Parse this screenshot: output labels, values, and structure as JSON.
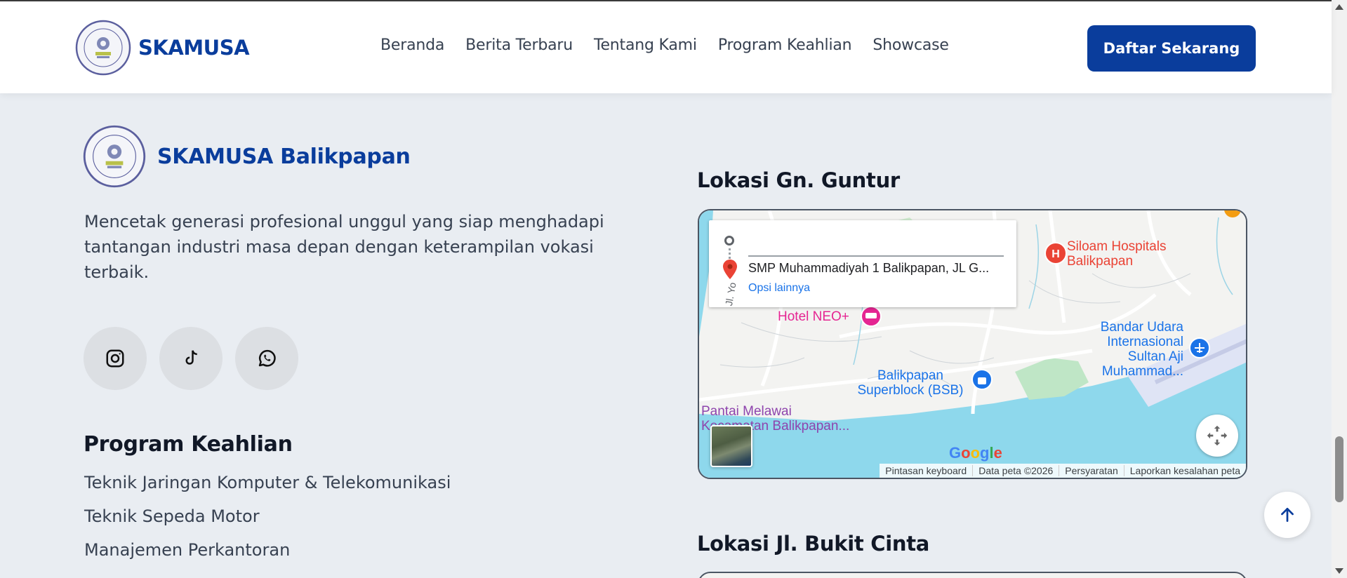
{
  "header": {
    "brand": "SKAMUSA",
    "nav": [
      "Beranda",
      "Berita Terbaru",
      "Tentang Kami",
      "Program Keahlian",
      "Showcase"
    ],
    "cta_label": "Daftar Sekarang"
  },
  "footer": {
    "brand": "SKAMUSA Balikpapan",
    "tagline": "Mencetak generasi profesional unggul yang siap menghadapi tantangan industri masa depan dengan keterampilan vokasi terbaik.",
    "socials": [
      "instagram-icon",
      "tiktok-icon",
      "whatsapp-icon"
    ],
    "programs_heading": "Program Keahlian",
    "programs": [
      "Teknik Jaringan Komputer & Telekomunikasi",
      "Teknik Sepeda Motor",
      "Manajemen Perkantoran"
    ]
  },
  "maps": {
    "gn_guntur": {
      "title": "Lokasi Gn. Guntur",
      "destination": "SMP Muhammadiyah 1 Balikpapan, JL G...",
      "more_options": "Opsi lainnya",
      "labels": {
        "hospital": "Siloam Hospitals\nBalikpapan",
        "hotel": "Hotel NEO+",
        "airport": "Bandar Udara\nInternasional\nSultan Aji\nMuhammad...",
        "mall": "Balikpapan\nSuperblock (BSB)",
        "beach": "Pantai Melawai\nKecamatan Balikpapan...",
        "street": "Jl. Yo"
      },
      "footer": [
        "Pintasan keyboard",
        "Data peta ©2026",
        "Persyaratan",
        "Laporkan kesalahan peta"
      ],
      "google": "Google"
    },
    "bukit_cinta": {
      "title": "Lokasi Jl. Bukit Cinta"
    }
  },
  "colors": {
    "brand": "#0a3d9c",
    "background": "#e9edf2",
    "hospital": "#ea4335",
    "hotel": "#e52592",
    "transit": "#1a73e8",
    "beach": "#8e44ad",
    "water": "#8ed8ec"
  }
}
